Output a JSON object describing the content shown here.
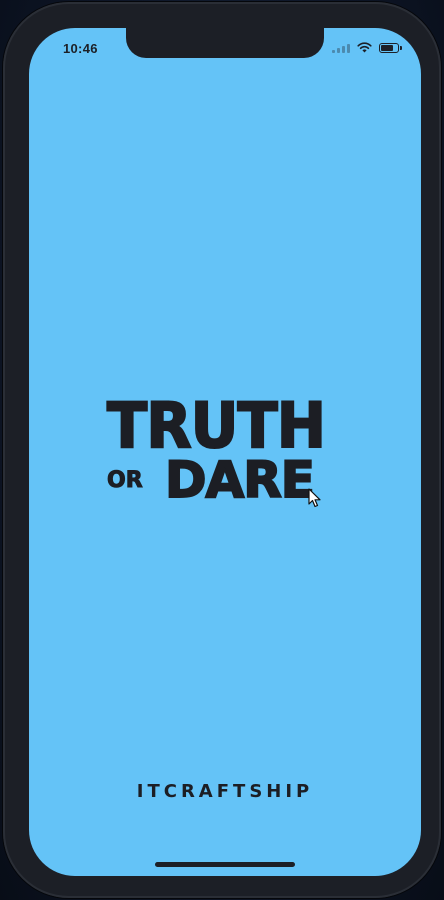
{
  "status_bar": {
    "time": "10:46",
    "icons": [
      "cellular-signal-icon",
      "wifi-icon",
      "battery-icon"
    ],
    "battery_level": 0.85
  },
  "logo": {
    "line1": "TRUTH",
    "line2_small": "OR",
    "line2_large": "DARE"
  },
  "brand": {
    "name": "ITCRAFTSHIP"
  },
  "colors": {
    "screen_background": "#64c3f7",
    "text_dark": "#1c1e24",
    "device_frame": "#1c1f26"
  }
}
